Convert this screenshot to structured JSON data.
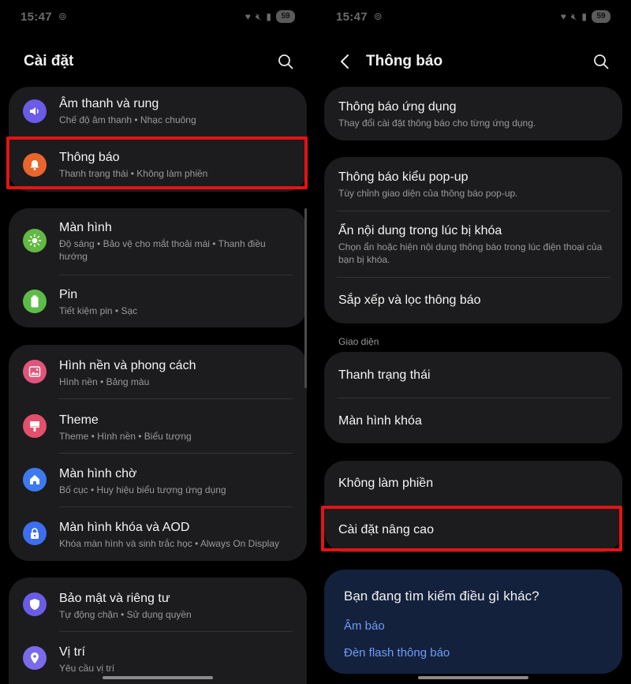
{
  "status_bar": {
    "time": "15:47",
    "battery": "59"
  },
  "colors": {
    "highlight": "#e41313",
    "card_bg": "#1c1c1e",
    "link": "#6e9cf5",
    "icon_sound": "#6b5be6",
    "icon_notif": "#e8652d",
    "icon_display": "#62b943",
    "icon_battery": "#5cbc48",
    "icon_wallpaper": "#e0557b",
    "icon_theme": "#e3506d",
    "icon_home": "#3d7af0",
    "icon_lock": "#3d6ef0",
    "icon_security": "#6b5ce6",
    "icon_location": "#7b6bea"
  },
  "left": {
    "title": "Cài đặt",
    "items": [
      {
        "title": "Âm thanh và rung",
        "subtitle": "Chế độ âm thanh  •  Nhạc chuông",
        "icon": "volume-icon"
      },
      {
        "title": "Thông báo",
        "subtitle": "Thanh trạng thái  •  Không làm phiền",
        "icon": "bell-icon"
      },
      {
        "title": "Màn hình",
        "subtitle": "Độ sáng  •  Bảo vệ cho mắt thoải mái  •  Thanh điều hướng",
        "icon": "brightness-icon"
      },
      {
        "title": "Pin",
        "subtitle": "Tiết kiệm pin  •  Sạc",
        "icon": "battery-icon"
      },
      {
        "title": "Hình nền và phong cách",
        "subtitle": "Hình nền  •  Bảng màu",
        "icon": "wallpaper-icon"
      },
      {
        "title": "Theme",
        "subtitle": "Theme  •  Hình nền  •  Biểu tượng",
        "icon": "theme-brush-icon"
      },
      {
        "title": "Màn hình chờ",
        "subtitle": "Bố cục  •  Huy hiệu biểu tượng ứng dụng",
        "icon": "home-icon"
      },
      {
        "title": "Màn hình khóa và AOD",
        "subtitle": "Khóa màn hình và sinh trắc học  •  Always On Display",
        "icon": "lock-icon"
      },
      {
        "title": "Bảo mật và riêng tư",
        "subtitle": "Tự động chặn  •  Sử dụng quyền",
        "icon": "shield-icon"
      },
      {
        "title": "Vị trí",
        "subtitle": "Yêu cầu vị trí",
        "icon": "location-pin-icon"
      }
    ]
  },
  "right": {
    "title": "Thông báo",
    "items": [
      {
        "title": "Thông báo ứng dụng",
        "subtitle": "Thay đổi cài đặt thông báo cho từng ứng dụng."
      },
      {
        "title": "Thông báo kiểu pop-up",
        "subtitle": "Tùy chỉnh giao diện của thông báo pop-up."
      },
      {
        "title": "Ẩn nội dung trong lúc bị khóa",
        "subtitle": "Chọn ẩn hoặc hiện nội dung thông báo trong lúc điện thoại của bạn bị khóa."
      },
      {
        "title": "Sắp xếp và lọc thông báo"
      },
      {
        "title": "Thanh trạng thái"
      },
      {
        "title": "Màn hình khóa"
      },
      {
        "title": "Không làm phiền"
      },
      {
        "title": "Cài đặt nâng cao"
      }
    ],
    "section_label": "Giao diện",
    "search_card": {
      "question": "Bạn đang tìm kiếm điều gì khác?",
      "links": [
        "Âm báo",
        "Đèn flash thông báo"
      ]
    }
  }
}
